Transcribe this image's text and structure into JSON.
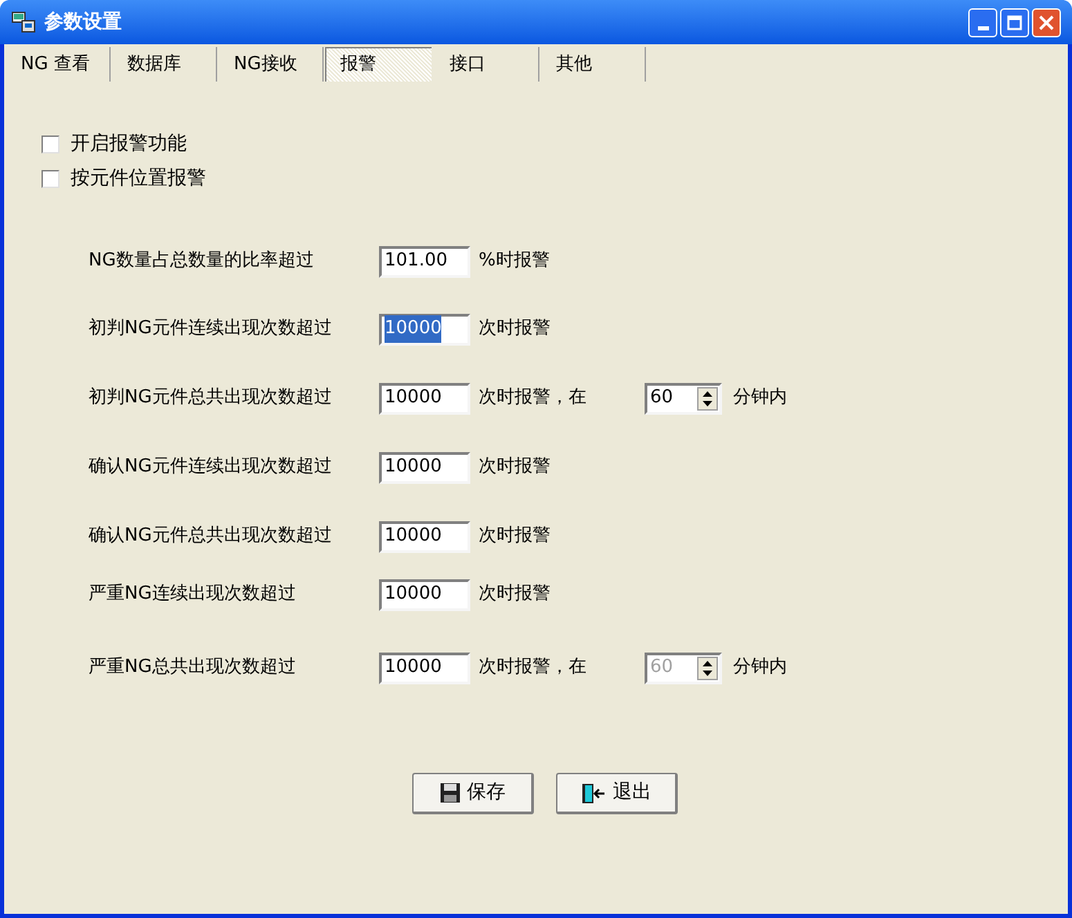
{
  "window": {
    "title": "参数设置"
  },
  "tabs": [
    {
      "label": "NG 查看",
      "selected": false
    },
    {
      "label": "数据库",
      "selected": false
    },
    {
      "label": "NG接收",
      "selected": false
    },
    {
      "label": "报警",
      "selected": true
    },
    {
      "label": "接口",
      "selected": false
    },
    {
      "label": "其他",
      "selected": false
    }
  ],
  "checkboxes": [
    {
      "label": "开启报警功能",
      "checked": false
    },
    {
      "label": "按元件位置报警",
      "checked": false
    }
  ],
  "rows": [
    {
      "label": "NG数量占总数量的比率超过",
      "value": "101.00",
      "value_selected": false,
      "suffix": "%时报警"
    },
    {
      "label": "初判NG元件连续出现次数超过",
      "value": "10000",
      "value_selected": true,
      "suffix": "次时报警"
    },
    {
      "label": "初判NG元件总共出现次数超过",
      "value": "10000",
      "value_selected": false,
      "suffix": "次时报警，在",
      "spinner": {
        "value": "60",
        "disabled": false
      },
      "unit": "分钟内"
    },
    {
      "label": "确认NG元件连续出现次数超过",
      "value": "10000",
      "value_selected": false,
      "suffix": "次时报警"
    },
    {
      "label": "确认NG元件总共出现次数超过",
      "value": "10000",
      "value_selected": false,
      "suffix": "次时报警"
    },
    {
      "label": "严重NG连续出现次数超过",
      "value": "10000",
      "value_selected": false,
      "suffix": "次时报警"
    },
    {
      "label": "严重NG总共出现次数超过",
      "value": "10000",
      "value_selected": false,
      "suffix": "次时报警，在",
      "spinner": {
        "value": "60",
        "disabled": true
      },
      "unit": "分钟内"
    }
  ],
  "buttons": [
    {
      "label": "保存",
      "kind": "save"
    },
    {
      "label": "退出",
      "kind": "exit"
    }
  ]
}
